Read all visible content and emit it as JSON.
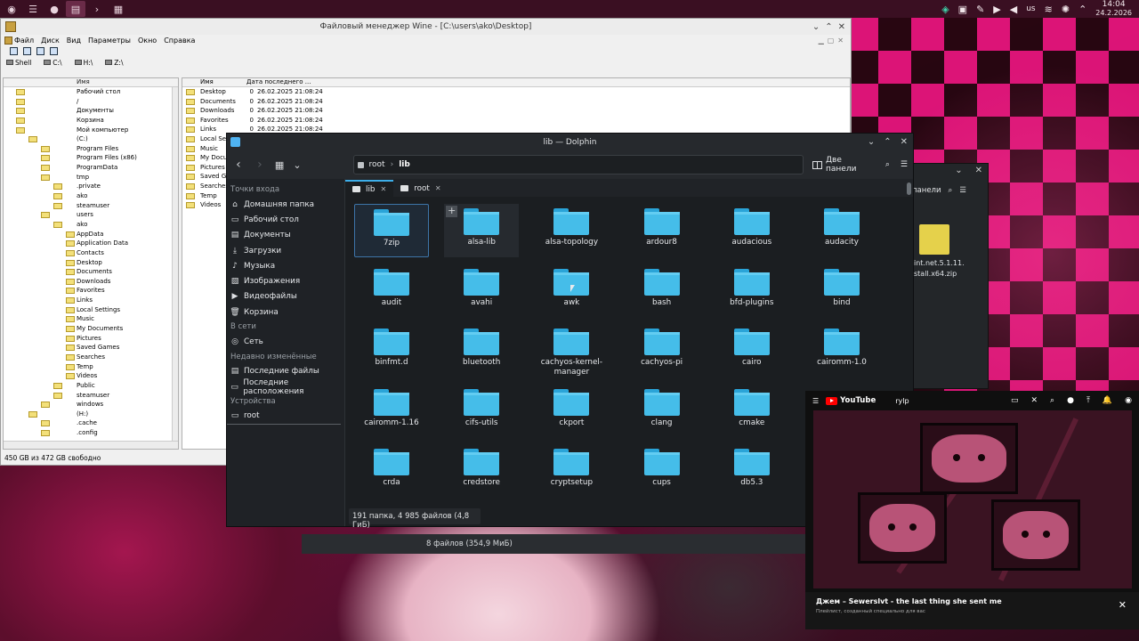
{
  "topbar": {
    "lang": "us",
    "time": "14:04",
    "date": "24.2.2026"
  },
  "wine": {
    "title": "Файловый менеджер Wine - [C:\\users\\ako\\Desktop]",
    "menu": [
      "Файл",
      "Диск",
      "Вид",
      "Параметры",
      "Окно",
      "Справка"
    ],
    "drives": [
      "Shell",
      "C:\\",
      "H:\\",
      "Z:\\"
    ],
    "tree_header": "Имя",
    "tree": [
      "Рабочий стол",
      "/",
      "Документы",
      "Корзина",
      "Мой компьютер",
      "(C:)",
      "Program Files",
      "Program Files (x86)",
      "ProgramData",
      "tmp",
      ".private",
      "ako",
      "steamuser",
      "users",
      "ako",
      "AppData",
      "Application Data",
      "Contacts",
      "Desktop",
      "Documents",
      "Downloads",
      "Favorites",
      "Links",
      "Local Settings",
      "Music",
      "My Documents",
      "Pictures",
      "Saved Games",
      "Searches",
      "Temp",
      "Videos",
      "Public",
      "steamuser",
      "windows",
      "(H:)",
      ".cache",
      ".config"
    ],
    "list_headers": [
      "Имя",
      "Дата последнего ..."
    ],
    "list": [
      {
        "name": "Desktop",
        "size": "0",
        "date": "26.02.2025  21:08:24"
      },
      {
        "name": "Documents",
        "size": "0",
        "date": "26.02.2025  21:08:24"
      },
      {
        "name": "Downloads",
        "size": "0",
        "date": "26.02.2025  21:08:24"
      },
      {
        "name": "Favorites",
        "size": "0",
        "date": "26.02.2025  21:08:24"
      },
      {
        "name": "Links",
        "size": "0",
        "date": "26.02.2025  21:08:24"
      },
      {
        "name": "Local Sett",
        "size": "",
        "date": ""
      },
      {
        "name": "Music",
        "size": "",
        "date": ""
      },
      {
        "name": "My Docum",
        "size": "",
        "date": ""
      },
      {
        "name": "Pictures",
        "size": "",
        "date": ""
      },
      {
        "name": "Saved Ga",
        "size": "",
        "date": ""
      },
      {
        "name": "Searches",
        "size": "",
        "date": ""
      },
      {
        "name": "Temp",
        "size": "",
        "date": ""
      },
      {
        "name": "Videos",
        "size": "",
        "date": ""
      }
    ],
    "status": "450 GB из 472 GB свободно"
  },
  "dolphin2": {
    "split_label": "панели",
    "file_name_1": "int.net.5.1.11.",
    "file_name_2": "stall.x64.zip"
  },
  "dolphin": {
    "title": "lib — Dolphin",
    "breadcrumb": [
      "root",
      "lib"
    ],
    "split_label": "Две панели",
    "sidebar": {
      "sections": [
        "Точки входа",
        "В сети",
        "Недавно изменённые",
        "Устройства"
      ],
      "places": [
        "Домашняя папка",
        "Рабочий стол",
        "Документы",
        "Загрузки",
        "Музыка",
        "Изображения",
        "Видеофайлы",
        "Корзина"
      ],
      "network": [
        "Сеть"
      ],
      "recent": [
        "Последние файлы",
        "Последние расположения"
      ],
      "devices": [
        "root"
      ]
    },
    "tabs": [
      "lib",
      "root"
    ],
    "folders": [
      [
        "7zip",
        "alsa-lib",
        "alsa-topology",
        "ardour8",
        "audacious",
        "audacity"
      ],
      [
        "audit",
        "avahi",
        "awk",
        "bash",
        "bfd-plugins",
        "bind"
      ],
      [
        "binfmt.d",
        "bluetooth",
        "cachyos-kernel-manager",
        "cachyos-pi",
        "cairo",
        "cairomm-1.0"
      ],
      [
        "cairomm-1.16",
        "cifs-utils",
        "ckport",
        "clang",
        "cmake",
        ""
      ],
      [
        "crda",
        "credstore",
        "cryptsetup",
        "cups",
        "db5.3",
        ""
      ]
    ],
    "status": "191 папка, 4 985 файлов (4,8 ГиБ)",
    "below_status": "8 файлов (354,9 МиБ)"
  },
  "youtube": {
    "logo": "YouTube",
    "search": "rylp",
    "title": "Джем – Sewerslvt - the last thing she sent me",
    "subtitle": "Плейлист, созданный специально для вас"
  }
}
